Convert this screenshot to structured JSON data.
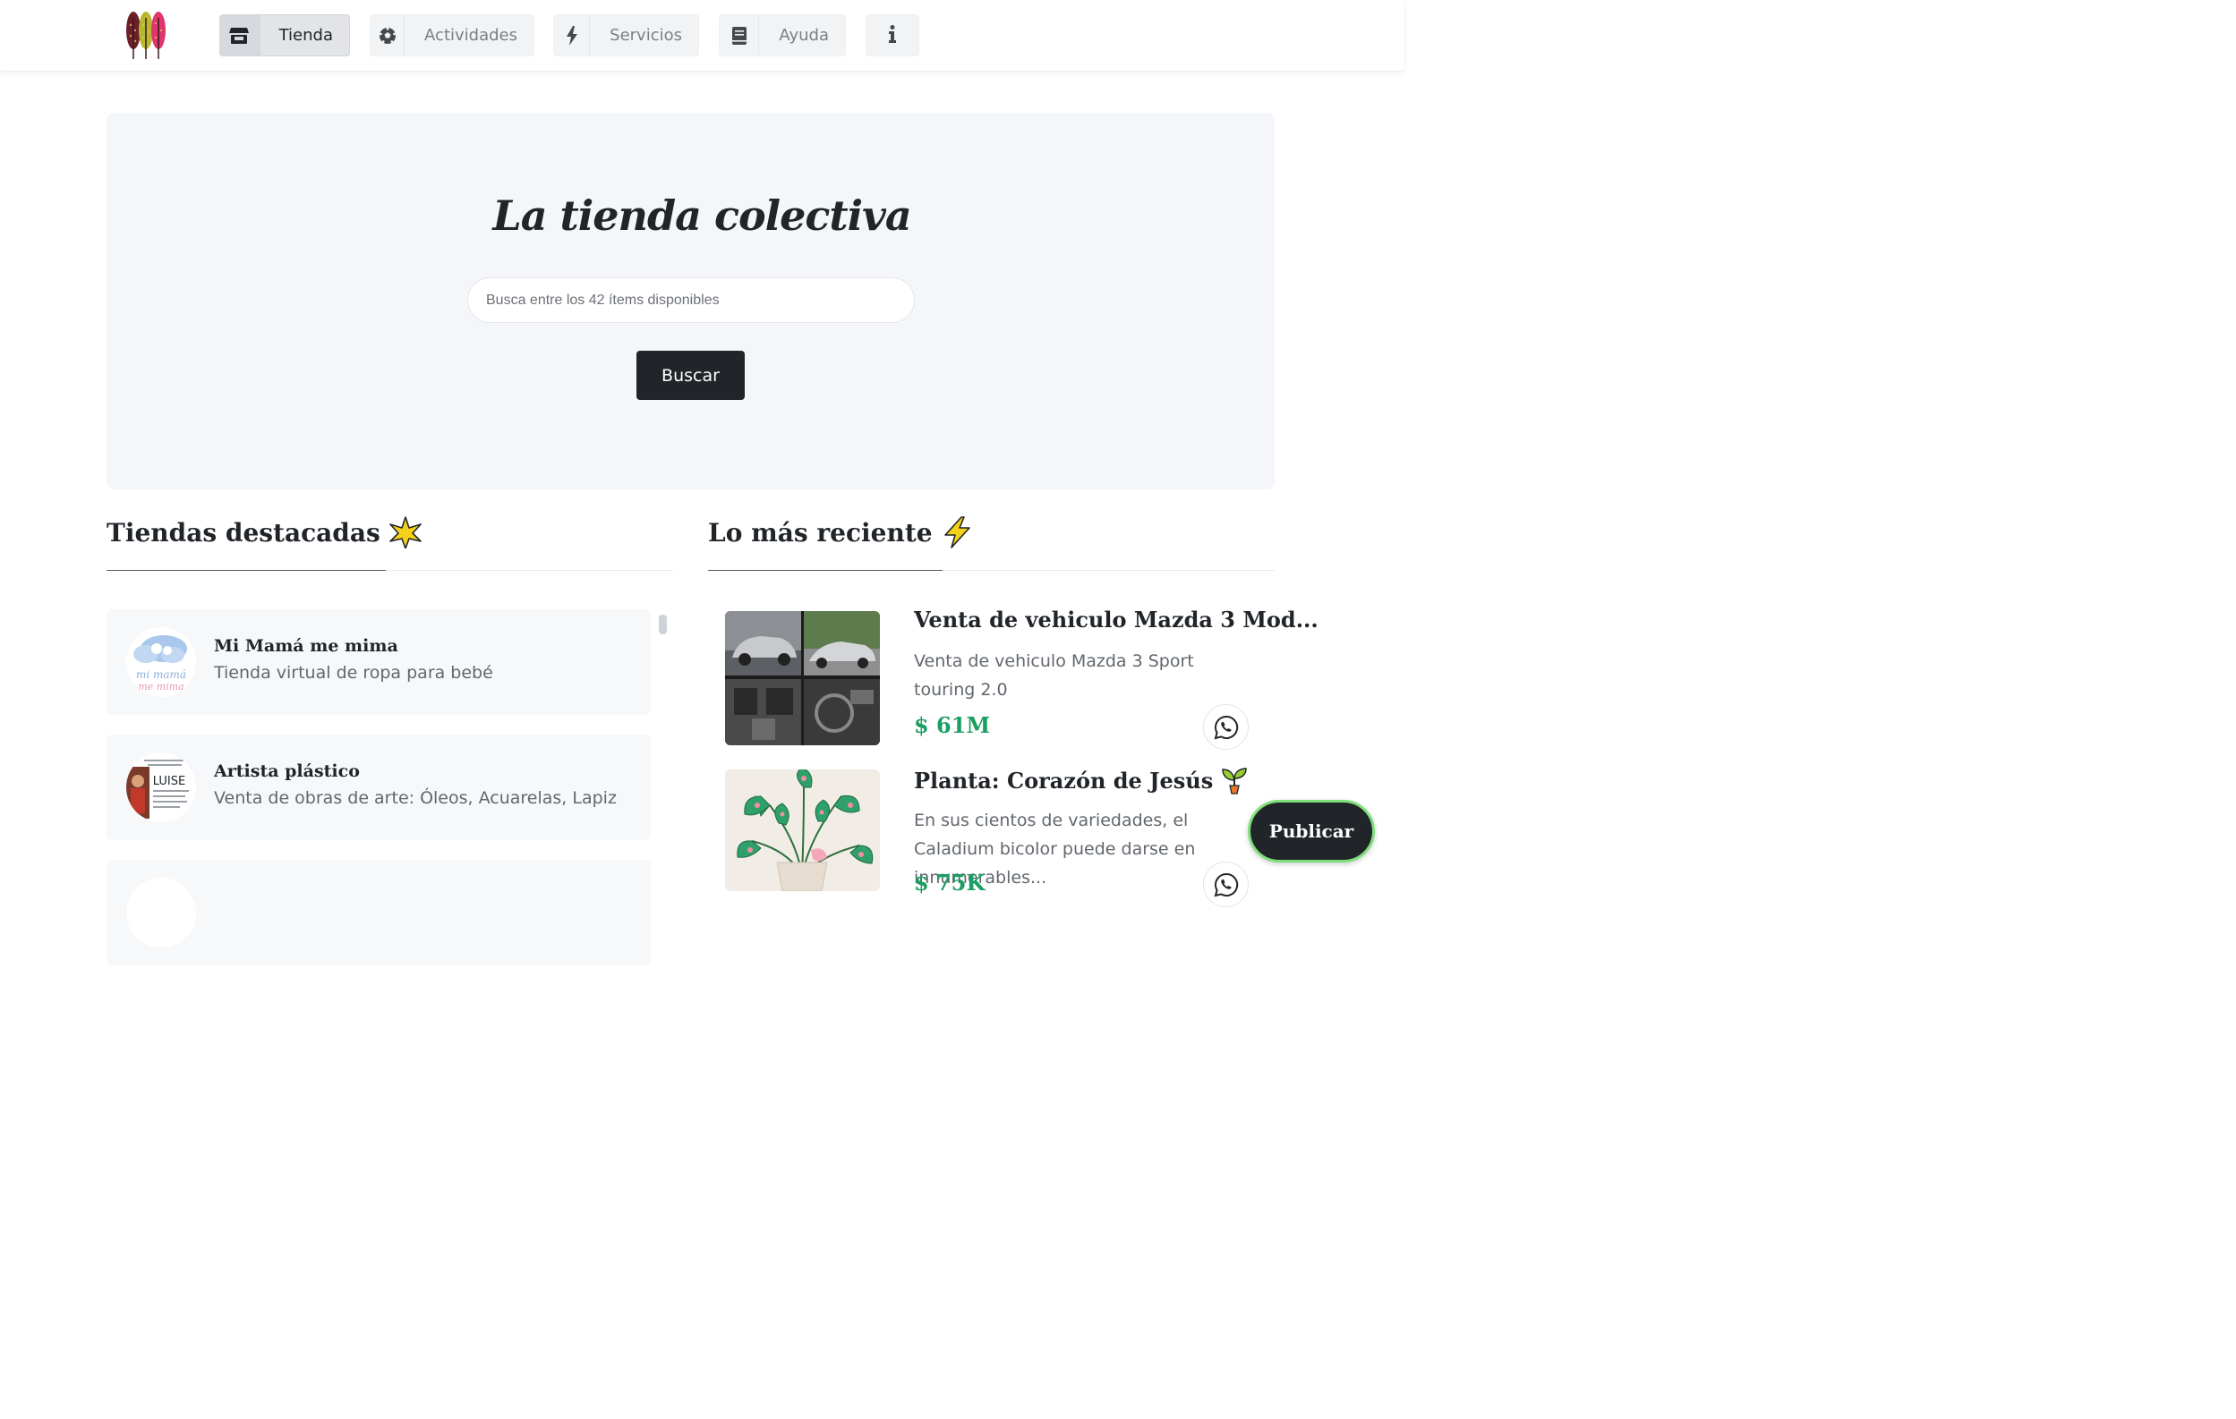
{
  "nav": {
    "items": [
      {
        "label": "Tienda",
        "icon": "store-icon",
        "active": true
      },
      {
        "label": "Actividades",
        "icon": "soccer-ball-icon",
        "active": false
      },
      {
        "label": "Servicios",
        "icon": "lightning-icon",
        "active": false
      },
      {
        "label": "Ayuda",
        "icon": "book-icon",
        "active": false
      },
      {
        "label": "",
        "icon": "info-icon",
        "active": false
      }
    ]
  },
  "hero": {
    "title": "La tienda colectiva",
    "search_placeholder": "Busca entre los 42 ítems disponibles",
    "search_value": "",
    "search_button": "Buscar"
  },
  "featured": {
    "title": "Tiendas destacadas",
    "icon": "star-icon",
    "stores": [
      {
        "name": "Mi Mamá me mima",
        "desc": "Tienda virtual de ropa para bebé",
        "avatar_text": "mi mamá me mima"
      },
      {
        "name": "Artista plástico",
        "desc": "Venta de obras de arte: Óleos, Acuarelas, Lapiz",
        "avatar_text": "LUISE"
      }
    ]
  },
  "recent": {
    "title": "Lo más reciente",
    "icon": "lightning-icon",
    "items": [
      {
        "title": "Venta de vehiculo Mazda 3 Mod...",
        "desc": "Venta de vehiculo Mazda 3 Sport touring 2.0",
        "price": "$ 61M",
        "icon": ""
      },
      {
        "title": "Planta: Corazón de Jesús",
        "desc": "En sus cientos de variedades, el Caladium bicolor puede darse en innumerables...",
        "price": "$ 75K",
        "icon": "sprout-icon"
      }
    ]
  },
  "publish_button": "Publicar",
  "colors": {
    "dark": "#212529",
    "hero_bg": "#f4f6fa",
    "price_green": "#1a9e62",
    "publish_border": "#7ee07a"
  }
}
